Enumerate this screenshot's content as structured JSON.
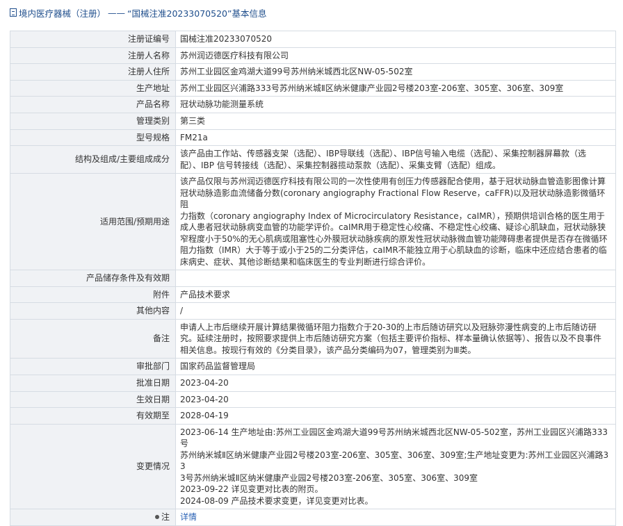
{
  "header": {
    "breadcrumb_section": "境内医疗器械（注册）",
    "separator": "——",
    "record_title": "“国械注准20233070520”基本信息"
  },
  "rows": {
    "reg_no": {
      "label": "注册证编号",
      "value": "国械注准20233070520"
    },
    "registrant": {
      "label": "注册人名称",
      "value": "苏州润迈德医疗科技有限公司"
    },
    "registrant_addr": {
      "label": "注册人住所",
      "value": "苏州工业园区金鸡湖大道99号苏州纳米城西北区NW-05-502室"
    },
    "prod_addr": {
      "label": "生产地址",
      "value": "苏州工业园区兴浦路333号苏州纳米城Ⅱ区纳米健康产业园2号楼203室-206室、305室、306室、309室"
    },
    "product_name": {
      "label": "产品名称",
      "value": "冠状动脉功能测量系统"
    },
    "mgmt_class": {
      "label": "管理类别",
      "value": "第三类"
    },
    "model": {
      "label": "型号规格",
      "value": "FM21a"
    },
    "structure": {
      "label": "结构及组成/主要组成成分",
      "lines": [
        "该产品由工作站、传感器支架（选配）、IBP导联线（选配）、IBP信号输入电缆（选配）、采集控制器屏幕款（选",
        "配）、IBP 信号转接线（选配）、采集控制器揽动泵款（选配）、采集支臂（选配）组成。"
      ]
    },
    "scope": {
      "label": "适用范围/预期用途",
      "lines": [
        "该产品仅限与苏州润迈德医疗科技有限公司的一次性使用有创压力传感器配合使用，基于冠状动脉血管造影图像计算",
        "冠状动脉造影血流储备分数(coronary angiography Fractional Flow Reserve，caFFR)以及冠状动脉造影微循环阻",
        "力指数（coronary angiography Index of Microcirculatory Resistance，caIMR），预期供培训合格的医生用于",
        "成人患者冠状动脉病变血管的功能学评价。caIMR用于稳定性心绞痛、不稳定性心绞痛、疑诊心肌缺血，冠状动脉狭",
        "窄程度小于50%的无心肌病或阻塞性心外膜冠状动脉疾病的原发性冠状动脉微血管功能障碍患者提供是否存在微循环",
        "阻力指数（IMR）大于等于或小于25的二分类评估，caIMR不能独立用于心肌缺血的诊断，临床中还应结合患者的临",
        "床病史、症状、其他诊断结果和临床医生的专业判断进行综合评价。"
      ]
    },
    "storage": {
      "label": "产品储存条件及有效期",
      "value": ""
    },
    "annex": {
      "label": "附件",
      "value": "产品技术要求"
    },
    "other": {
      "label": "其他内容",
      "value": "/"
    },
    "remark": {
      "label": "备注",
      "lines": [
        "申请人上市后继续开展计算结果微循环阻力指数介于20-30的上市后随访研究以及冠脉弥漫性病变的上市后随访研",
        "究。延续注册时，按照要求提供上市后随访研究方案（包括主要评价指标、样本量确认依据等）、报告以及不良事件",
        "相关信息。按现行有效的《分类目录》，该产品分类编码为07，管理类别为Ⅲ类。"
      ]
    },
    "authority": {
      "label": "审批部门",
      "value": "国家药品监督管理局"
    },
    "approve_date": {
      "label": "批准日期",
      "value": "2023-04-20"
    },
    "effective_date": {
      "label": "生效日期",
      "value": "2023-04-20"
    },
    "expiry": {
      "label": "有效期至",
      "value": "2028-04-19"
    },
    "changes": {
      "label": "变更情况",
      "lines": [
        "2023-06-14 生产地址由:苏州工业园区金鸡湖大道99号苏州纳米城西北区NW-05-502室，苏州工业园区兴浦路333号",
        "苏州纳米城Ⅱ区纳米健康产业园2号楼203室-206室、305室、306室、309室;生产地址变更为:苏州工业园区兴浦路33",
        "3号苏州纳米城Ⅱ区纳米健康产业园2号楼203室-206室、305室、306室、309室",
        "2023-09-22 详见变更对比表的附页。",
        "2024-08-09 产品技术要求变更，详见变更对比表。"
      ]
    },
    "note": {
      "label": "注",
      "link_text": "详情"
    }
  }
}
